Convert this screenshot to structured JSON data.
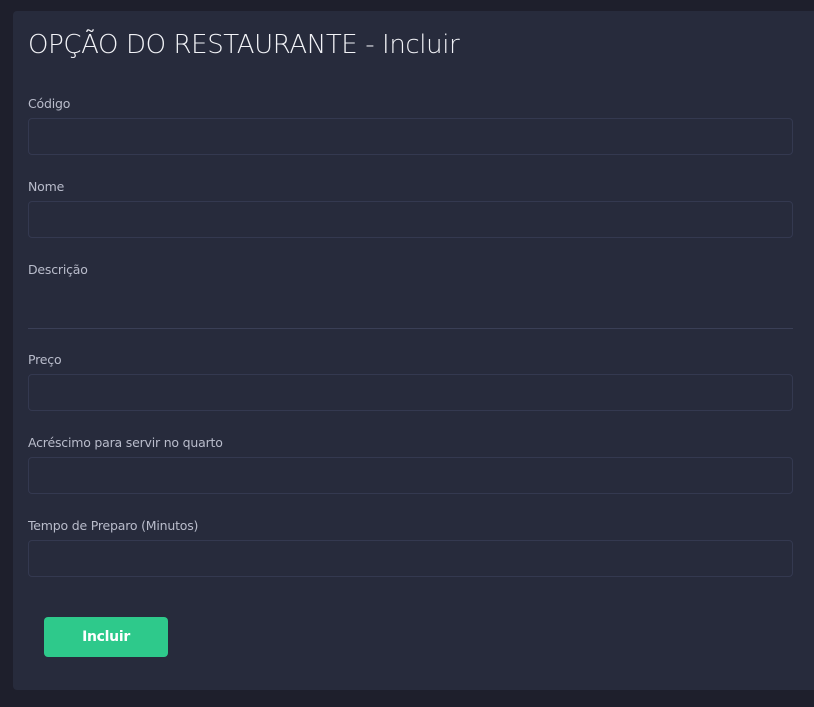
{
  "form": {
    "title": "OPÇÃO DO RESTAURANTE - Incluir",
    "fields": [
      {
        "label": "Código",
        "value": ""
      },
      {
        "label": "Nome",
        "value": ""
      },
      {
        "label": "Descrição",
        "value": ""
      },
      {
        "label": "Preço",
        "value": ""
      },
      {
        "label": "Acréscimo para servir no quarto",
        "value": ""
      },
      {
        "label": "Tempo de Preparo (Minutos)",
        "value": ""
      }
    ],
    "submit_label": "Incluir"
  },
  "colors": {
    "page_background": "#1e1f2c",
    "card_background": "#272b3c",
    "accent": "#2ec98b"
  }
}
